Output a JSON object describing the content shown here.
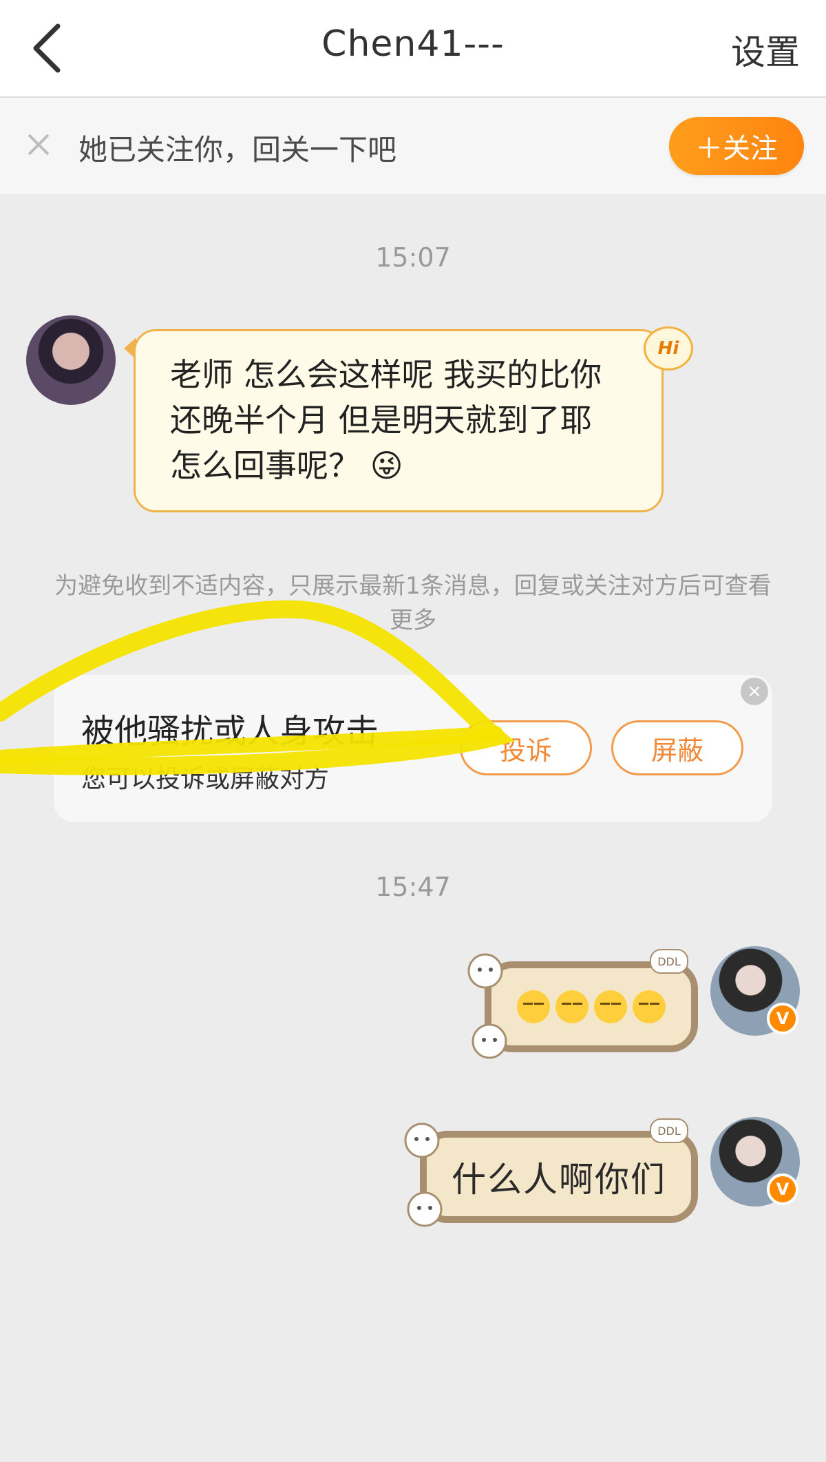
{
  "header": {
    "title": "Chen41---",
    "settings_label": "设置"
  },
  "follow_bar": {
    "text": "她已关注你，回关一下吧",
    "button_label": "＋关注"
  },
  "messages": {
    "time1": "15:07",
    "incoming_text": "老师 怎么会这样呢 我买的比你还晚半个月 但是明天就到了耶 怎么回事呢？ 😜",
    "hi_badge": "Hi",
    "notice": "为避免收到不适内容，只展示最新1条消息，回复或关注对方后可查看更多",
    "time2": "15:47",
    "outgoing_1_emojis": [
      "sleeping-face-emoji",
      "sleeping-face-emoji",
      "sleeping-face-emoji",
      "sleeping-face-emoji"
    ],
    "outgoing_2_text": "什么人啊你们",
    "ddl_tag": "DDL",
    "verified_badge": "V"
  },
  "report_card": {
    "title": "被他骚扰或人身攻击",
    "subtitle": "您可以投诉或屏蔽对方",
    "report_label": "投诉",
    "block_label": "屏蔽",
    "close_glyph": "×"
  },
  "colors": {
    "accent_orange": "#ff8a00",
    "bubble_border": "#f0b34c",
    "highlight_yellow": "#f5e400"
  }
}
